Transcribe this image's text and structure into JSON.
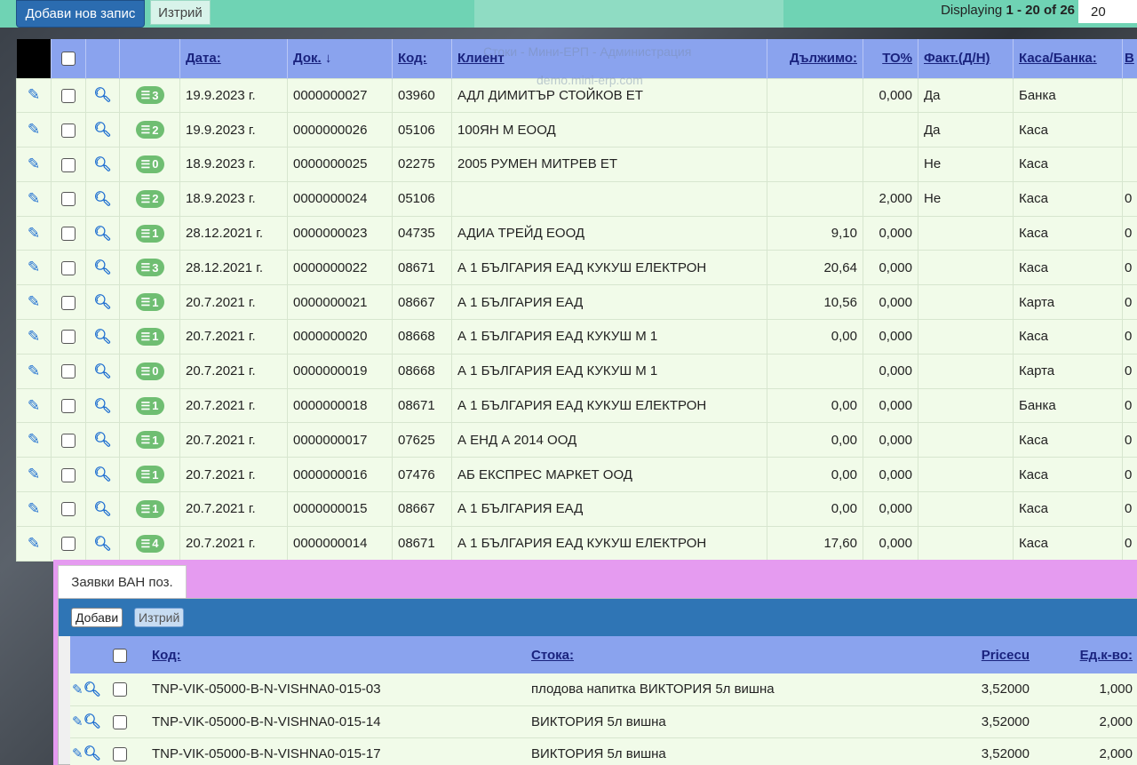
{
  "toolbar": {
    "add_label": "Добави нов запис",
    "delete_label": "Изтрий",
    "displaying_prefix": "Displaying",
    "range": "1 - 20",
    "of_word": "of",
    "total": "26",
    "page_size": "20"
  },
  "window_overlay": {
    "title": "Стоки - Мини-ЕРП - Администрация",
    "url": "demo.mini-erp.com"
  },
  "grid": {
    "columns": [
      "Дата:",
      "Док.",
      "Код:",
      "Клиент",
      "Дължимо:",
      "ТО%",
      "Факт.(Д/Н)",
      "Каса/Банка:",
      "В"
    ],
    "sort_indicator": "↓",
    "rows": [
      {
        "count": "3",
        "date": "19.9.2023 г.",
        "doc": "0000000027",
        "code": "03960",
        "client": "АДЛ ДИМИТЪР СТОЙКОВ ЕТ",
        "due": "",
        "to": "0,000",
        "fact": "Да",
        "cash": "Банка",
        "v": ""
      },
      {
        "count": "2",
        "date": "19.9.2023 г.",
        "doc": "0000000026",
        "code": "05106",
        "client": "100ЯН М ЕООД",
        "due": "",
        "to": "",
        "fact": "Да",
        "cash": "Каса",
        "v": ""
      },
      {
        "count": "0",
        "date": "18.9.2023 г.",
        "doc": "0000000025",
        "code": "02275",
        "client": "2005 РУМЕН МИТРЕВ ЕТ",
        "due": "",
        "to": "",
        "fact": "Не",
        "cash": "Каса",
        "v": ""
      },
      {
        "count": "2",
        "date": "18.9.2023 г.",
        "doc": "0000000024",
        "code": "05106",
        "client": "",
        "due": "",
        "to": "2,000",
        "fact": "Не",
        "cash": "Каса",
        "v": "0"
      },
      {
        "count": "1",
        "date": "28.12.2021 г.",
        "doc": "0000000023",
        "code": "04735",
        "client": "АДИА ТРЕЙД ЕООД",
        "due": "9,10",
        "to": "0,000",
        "fact": "",
        "cash": "Каса",
        "v": "0"
      },
      {
        "count": "3",
        "date": "28.12.2021 г.",
        "doc": "0000000022",
        "code": "08671",
        "client": "А 1 БЪЛГАРИЯ ЕАД КУКУШ ЕЛЕКТРОН",
        "due": "20,64",
        "to": "0,000",
        "fact": "",
        "cash": "Каса",
        "v": "0"
      },
      {
        "count": "1",
        "date": "20.7.2021 г.",
        "doc": "0000000021",
        "code": "08667",
        "client": "А 1 БЪЛГАРИЯ ЕАД",
        "due": "10,56",
        "to": "0,000",
        "fact": "",
        "cash": "Карта",
        "v": "0"
      },
      {
        "count": "1",
        "date": "20.7.2021 г.",
        "doc": "0000000020",
        "code": "08668",
        "client": "А 1 БЪЛГАРИЯ ЕАД КУКУШ М 1",
        "due": "0,00",
        "to": "0,000",
        "fact": "",
        "cash": "Каса",
        "v": "0"
      },
      {
        "count": "0",
        "date": "20.7.2021 г.",
        "doc": "0000000019",
        "code": "08668",
        "client": "А 1 БЪЛГАРИЯ ЕАД КУКУШ М 1",
        "due": "",
        "to": "0,000",
        "fact": "",
        "cash": "Карта",
        "v": "0"
      },
      {
        "count": "1",
        "date": "20.7.2021 г.",
        "doc": "0000000018",
        "code": "08671",
        "client": "А 1 БЪЛГАРИЯ ЕАД КУКУШ ЕЛЕКТРОН",
        "due": "0,00",
        "to": "0,000",
        "fact": "",
        "cash": "Банка",
        "v": "0"
      },
      {
        "count": "1",
        "date": "20.7.2021 г.",
        "doc": "0000000017",
        "code": "07625",
        "client": "А ЕНД А 2014 ООД",
        "due": "0,00",
        "to": "0,000",
        "fact": "",
        "cash": "Каса",
        "v": "0"
      },
      {
        "count": "1",
        "date": "20.7.2021 г.",
        "doc": "0000000016",
        "code": "07476",
        "client": "АБ ЕКСПРЕС МАРКЕТ ООД",
        "due": "0,00",
        "to": "0,000",
        "fact": "",
        "cash": "Каса",
        "v": "0"
      },
      {
        "count": "1",
        "date": "20.7.2021 г.",
        "doc": "0000000015",
        "code": "08667",
        "client": "А 1 БЪЛГАРИЯ ЕАД",
        "due": "0,00",
        "to": "0,000",
        "fact": "",
        "cash": "Каса",
        "v": "0"
      },
      {
        "count": "4",
        "date": "20.7.2021 г.",
        "doc": "0000000014",
        "code": "08671",
        "client": "А 1 БЪЛГАРИЯ ЕАД КУКУШ ЕЛЕКТРОН",
        "due": "17,60",
        "to": "0,000",
        "fact": "",
        "cash": "Каса",
        "v": "0"
      }
    ]
  },
  "detail": {
    "tab_label": "Заявки ВАН поз.",
    "add_label": "Добави",
    "delete_label": "Изтрий",
    "columns": [
      "Код:",
      "Стока:",
      "Pricecu",
      "Ед.к-во:"
    ],
    "rows": [
      {
        "code": "TNP-VIK-05000-B-N-VISHNA0-015-03",
        "item": "плодова напитка ВИКТОРИЯ 5л вишна",
        "price": "3,52000",
        "qty": "1,000"
      },
      {
        "code": "TNP-VIK-05000-B-N-VISHNA0-015-14",
        "item": "ВИКТОРИЯ 5л вишна",
        "price": "3,52000",
        "qty": "2,000"
      },
      {
        "code": "TNP-VIK-05000-B-N-VISHNA0-015-17",
        "item": "ВИКТОРИЯ 5л вишна",
        "price": "3,52000",
        "qty": "2,000"
      }
    ]
  },
  "colors": {
    "toolbar_bg": "#6fd3b4",
    "header_bg": "#8aa3ee",
    "row_bg": "#f1fbe9",
    "detail_bg": "#e59bf0",
    "sub_toolbar_bg": "#2f75b5",
    "primary_button": "#2b6cb0",
    "badge": "#6fbe72"
  }
}
